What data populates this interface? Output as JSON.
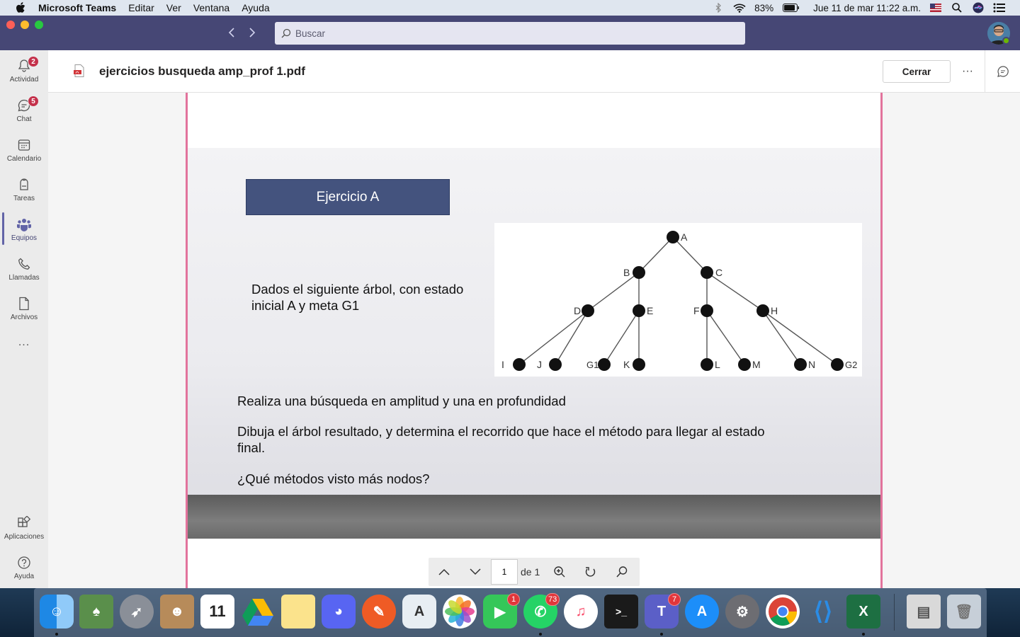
{
  "menubar": {
    "app_name": "Microsoft Teams",
    "menus": [
      "Editar",
      "Ver",
      "Ventana",
      "Ayuda"
    ],
    "battery": "83%",
    "datetime": "Jue 11 de mar  11:22 a.m."
  },
  "titlebar": {
    "search_placeholder": "Buscar"
  },
  "rail": {
    "items": [
      {
        "label": "Actividad",
        "badge": "2"
      },
      {
        "label": "Chat",
        "badge": "5"
      },
      {
        "label": "Calendario"
      },
      {
        "label": "Tareas"
      },
      {
        "label": "Equipos"
      },
      {
        "label": "Llamadas"
      },
      {
        "label": "Archivos"
      },
      {
        "label": "..."
      }
    ],
    "bottom": [
      {
        "label": "Aplicaciones"
      },
      {
        "label": "Ayuda"
      }
    ]
  },
  "document": {
    "title": "ejercicios busqueda amp_prof 1.pdf",
    "close_label": "Cerrar",
    "more_label": "···"
  },
  "slide": {
    "heading": "Ejercicio A",
    "intro": "Dados el siguiente árbol, con estado inicial A y meta G1",
    "line1": "Realiza una búsqueda en amplitud y una en profundidad",
    "line2": "Dibuja el árbol resultado, y determina el recorrido que hace el método para llegar al estado final.",
    "line3": "¿Qué métodos visto más nodos?",
    "tree": {
      "nodes": [
        "A",
        "B",
        "C",
        "D",
        "E",
        "F",
        "H",
        "I",
        "J",
        "G1",
        "K",
        "L",
        "M",
        "N",
        "G2"
      ],
      "edges": [
        [
          "A",
          "B"
        ],
        [
          "A",
          "C"
        ],
        [
          "B",
          "D"
        ],
        [
          "B",
          "E"
        ],
        [
          "C",
          "F"
        ],
        [
          "C",
          "H"
        ],
        [
          "D",
          "I"
        ],
        [
          "D",
          "J"
        ],
        [
          "E",
          "G1"
        ],
        [
          "E",
          "K"
        ],
        [
          "F",
          "L"
        ],
        [
          "F",
          "M"
        ],
        [
          "H",
          "N"
        ],
        [
          "H",
          "G2"
        ]
      ]
    }
  },
  "pager": {
    "page": "1",
    "of": "de 1"
  },
  "dock": {
    "badges": {
      "facetime": "1",
      "whatsapp": "73",
      "teams": "7"
    }
  }
}
